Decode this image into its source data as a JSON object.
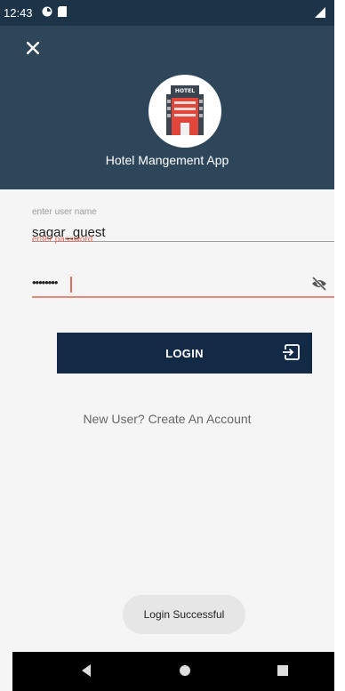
{
  "status_bar": {
    "time": "12:43",
    "icons": [
      "sync-icon",
      "sim-card-icon",
      "signal-icon"
    ]
  },
  "header": {
    "close_icon": "close-icon",
    "logo_text": "HOTEL",
    "app_title": "Hotel Mangement App"
  },
  "form": {
    "username": {
      "label": "enter user name",
      "value": "sagar_guest"
    },
    "password": {
      "label": "enter password",
      "value": "••••••••",
      "toggle_icon": "eye-off-icon"
    }
  },
  "login_button": {
    "label": "LOGIN",
    "icon": "login-icon"
  },
  "create_account_link": "New User? Create An Account",
  "toast": "Login Successful",
  "nav_bar": {
    "icons": [
      "back-icon",
      "home-icon",
      "recents-icon"
    ]
  },
  "colors": {
    "header_bg": "#2e4659",
    "button_bg": "#132a46",
    "error": "#e06b5b",
    "logo_red": "#e2463b"
  }
}
